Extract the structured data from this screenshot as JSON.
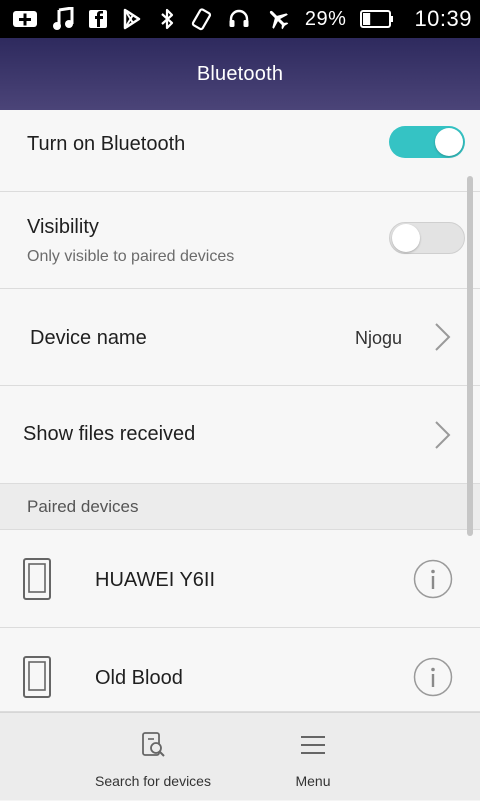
{
  "status_bar": {
    "left_icons": [
      "add-box-icon",
      "music-note-icon",
      "facebook-icon",
      "play-store-icon"
    ],
    "right_icons": [
      "bluetooth-icon",
      "vibrate-icon",
      "headset-icon",
      "airplane-icon"
    ],
    "battery_percent": "29%",
    "battery_level": 0.29,
    "time": "10:39"
  },
  "app_bar": {
    "title": "Bluetooth"
  },
  "settings": {
    "bluetooth": {
      "label": "Turn on Bluetooth",
      "enabled": true
    },
    "visibility": {
      "label": "Visibility",
      "subtitle": "Only visible to paired devices",
      "enabled": false
    },
    "device_name": {
      "label": "Device name",
      "value": "Njogu"
    },
    "files": {
      "label": "Show files received"
    }
  },
  "paired": {
    "header": "Paired devices",
    "devices": [
      {
        "name": "HUAWEI Y6II",
        "icon": "phone-icon",
        "action_icon": "info-icon"
      },
      {
        "name": "Old Blood",
        "icon": "phone-icon",
        "action_icon": "info-icon"
      }
    ]
  },
  "bottom_bar": {
    "search_label": "Search for devices",
    "menu_label": "Menu"
  },
  "colors": {
    "accent": "#35c3c4",
    "header_top": "#2e2a5e",
    "header_bottom": "#4b4478"
  }
}
